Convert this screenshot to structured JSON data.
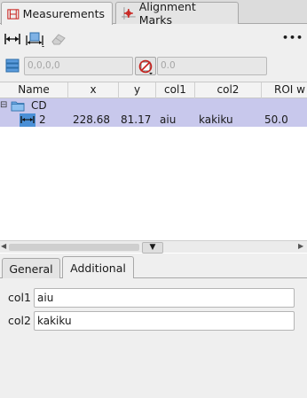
{
  "tabs": [
    {
      "label": "Measurements",
      "icon": "measurements-icon",
      "active": true
    },
    {
      "label": "Alignment Marks",
      "icon": "alignment-marks-icon",
      "active": false
    }
  ],
  "toolbar": {
    "more_label": "•••",
    "coord_placeholder": "0,0,0,0",
    "value_placeholder": "0.0"
  },
  "table": {
    "columns": [
      "Name",
      "x",
      "y",
      "col1",
      "col2",
      "ROI w"
    ],
    "group": {
      "name": "CD",
      "expander": "⊟"
    },
    "row": {
      "name": "2",
      "x": "228.68",
      "y": "81.17",
      "col1": "aiu",
      "col2": "kakiku",
      "roi_w": "50.0"
    }
  },
  "splitter_label": "▼",
  "scroll": {
    "left": "◀",
    "right": "▶"
  },
  "lower_tabs": [
    {
      "label": "General",
      "active": false
    },
    {
      "label": "Additional",
      "active": true
    }
  ],
  "form": {
    "col1_label": "col1",
    "col1_value": "aiu",
    "col2_label": "col2",
    "col2_value": "kakiku"
  },
  "colors": {
    "selection": "#c8c8ec",
    "accent_red": "#c8201c",
    "accent_blue": "#2c7bbf"
  }
}
